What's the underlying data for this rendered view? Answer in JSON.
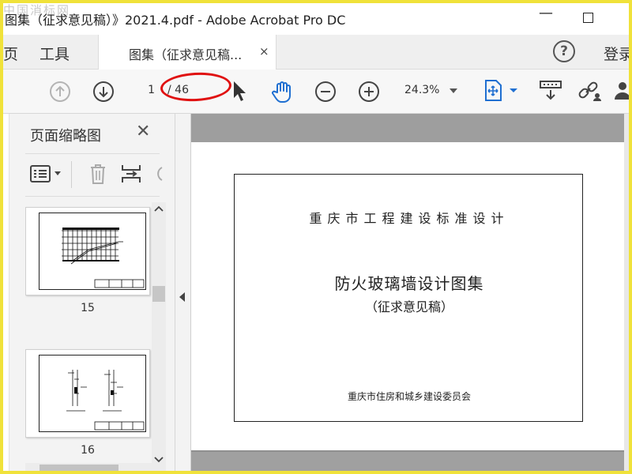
{
  "window": {
    "watermark": "中国消标网",
    "title": "图集（征求意见稿）》2021.4.pdf - Adobe Acrobat Pro DC",
    "minimize_glyph": "—"
  },
  "tabs": {
    "home": "页",
    "tools": "工具",
    "document": "图集（征求意见稿...",
    "close_glyph": "×",
    "help_glyph": "?",
    "login": "登录"
  },
  "toolbar": {
    "current_page": "1",
    "total_pages": "/ 46",
    "zoom": "24.3%"
  },
  "panel": {
    "title": "页面缩略图",
    "close_glyph": "✕",
    "thumbnails": [
      {
        "label": "15"
      },
      {
        "label": "16"
      }
    ]
  },
  "document": {
    "organization": "重庆市工程建设标准设计",
    "title": "防火玻璃墙设计图集",
    "subtitle": "（征求意见稿）",
    "issuer": "重庆市住房和城乡建设委员会"
  },
  "colors": {
    "frame": "#f0e23a",
    "highlight": "#e01010",
    "accent": "#1f6fd1"
  }
}
